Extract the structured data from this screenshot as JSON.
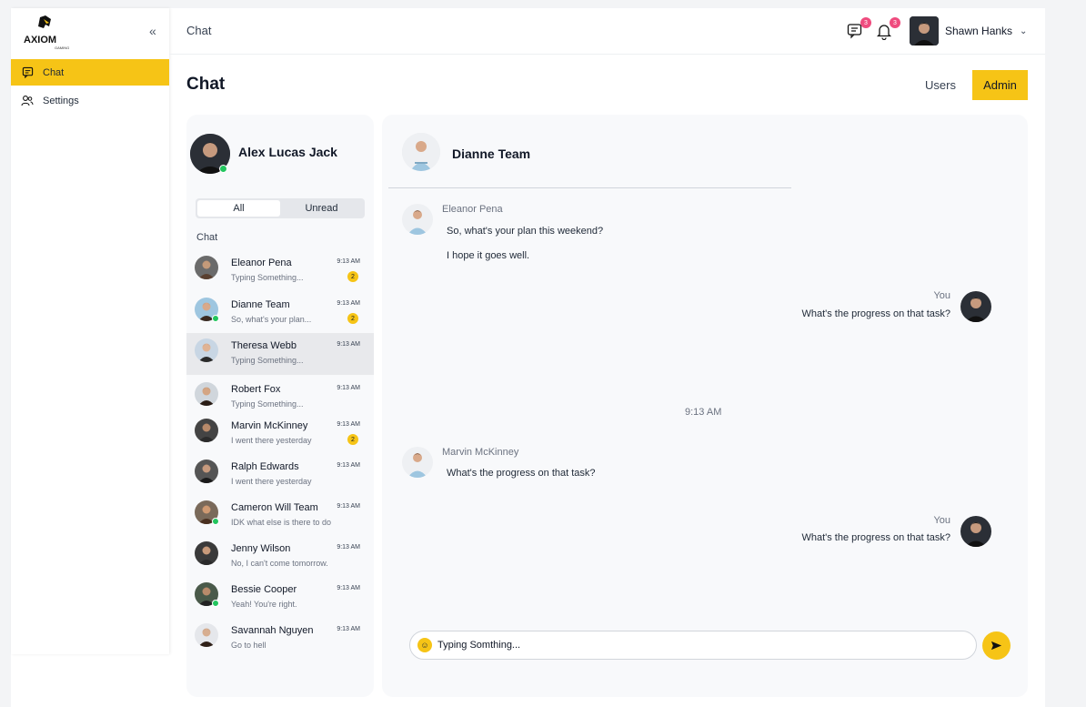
{
  "brand": {
    "name": "AXIOM",
    "tagline": "GAMING",
    "accent": "#f6c416"
  },
  "sidebar": {
    "items": [
      {
        "label": "Chat",
        "icon": "chat-icon",
        "active": true
      },
      {
        "label": "Settings",
        "icon": "users-icon",
        "active": false
      }
    ]
  },
  "topbar": {
    "breadcrumb": "Chat",
    "messages_badge": "3",
    "notifications_badge": "3",
    "user_name": "Shawn Hanks"
  },
  "page": {
    "title": "Chat",
    "users_link": "Users",
    "admin_button": "Admin"
  },
  "list": {
    "me_name": "Alex Lucas Jack",
    "filters": [
      "All",
      "Unread"
    ],
    "section_label": "Chat",
    "chats": [
      {
        "name": "Eleanor Pena",
        "preview": "Typing Something...",
        "time": "9:13 AM",
        "badge": "2",
        "online": false
      },
      {
        "name": "Dianne Team",
        "preview": "So, what's your plan...",
        "time": "9:13 AM",
        "badge": "2",
        "online": true
      },
      {
        "name": "Theresa Webb",
        "preview": "Typing Something...",
        "time": "9:13 AM",
        "badge": "",
        "online": false,
        "selected": true
      },
      {
        "name": "Robert Fox",
        "preview": "Typing Something...",
        "time": "9:13 AM",
        "badge": "",
        "online": false
      },
      {
        "name": "Marvin McKinney",
        "preview": "I went there yesterday",
        "time": "9:13 AM",
        "badge": "2",
        "online": false
      },
      {
        "name": "Ralph Edwards",
        "preview": "I went there yesterday",
        "time": "9:13 AM",
        "badge": "",
        "online": false
      },
      {
        "name": "Cameron Will Team",
        "preview": "IDK what else is there to do",
        "time": "9:13 AM",
        "badge": "",
        "online": true
      },
      {
        "name": "Jenny Wilson",
        "preview": "No, I can't come tomorrow.",
        "time": "9:13 AM",
        "badge": "",
        "online": false
      },
      {
        "name": "Bessie Cooper",
        "preview": "Yeah! You're right.",
        "time": "9:13 AM",
        "badge": "",
        "online": true
      },
      {
        "name": "Savannah Nguyen",
        "preview": "Go to hell",
        "time": "9:13 AM",
        "badge": "",
        "online": false
      }
    ]
  },
  "conversation": {
    "title": "Dianne Team",
    "msg1_sender": "Eleanor Pena",
    "msg1_line1": "So, what's your plan this weekend?",
    "msg1_line2": "I hope it goes well.",
    "msg2_sender": "You",
    "msg2_text": "What's the progress on that task?",
    "time_divider": "9:13 AM",
    "msg3_sender": "Marvin McKinney",
    "msg3_text": "What's the progress on that task?",
    "msg4_sender": "You",
    "msg4_text": "What's the progress on that task?"
  },
  "composer": {
    "value": "Typing Somthing..."
  }
}
